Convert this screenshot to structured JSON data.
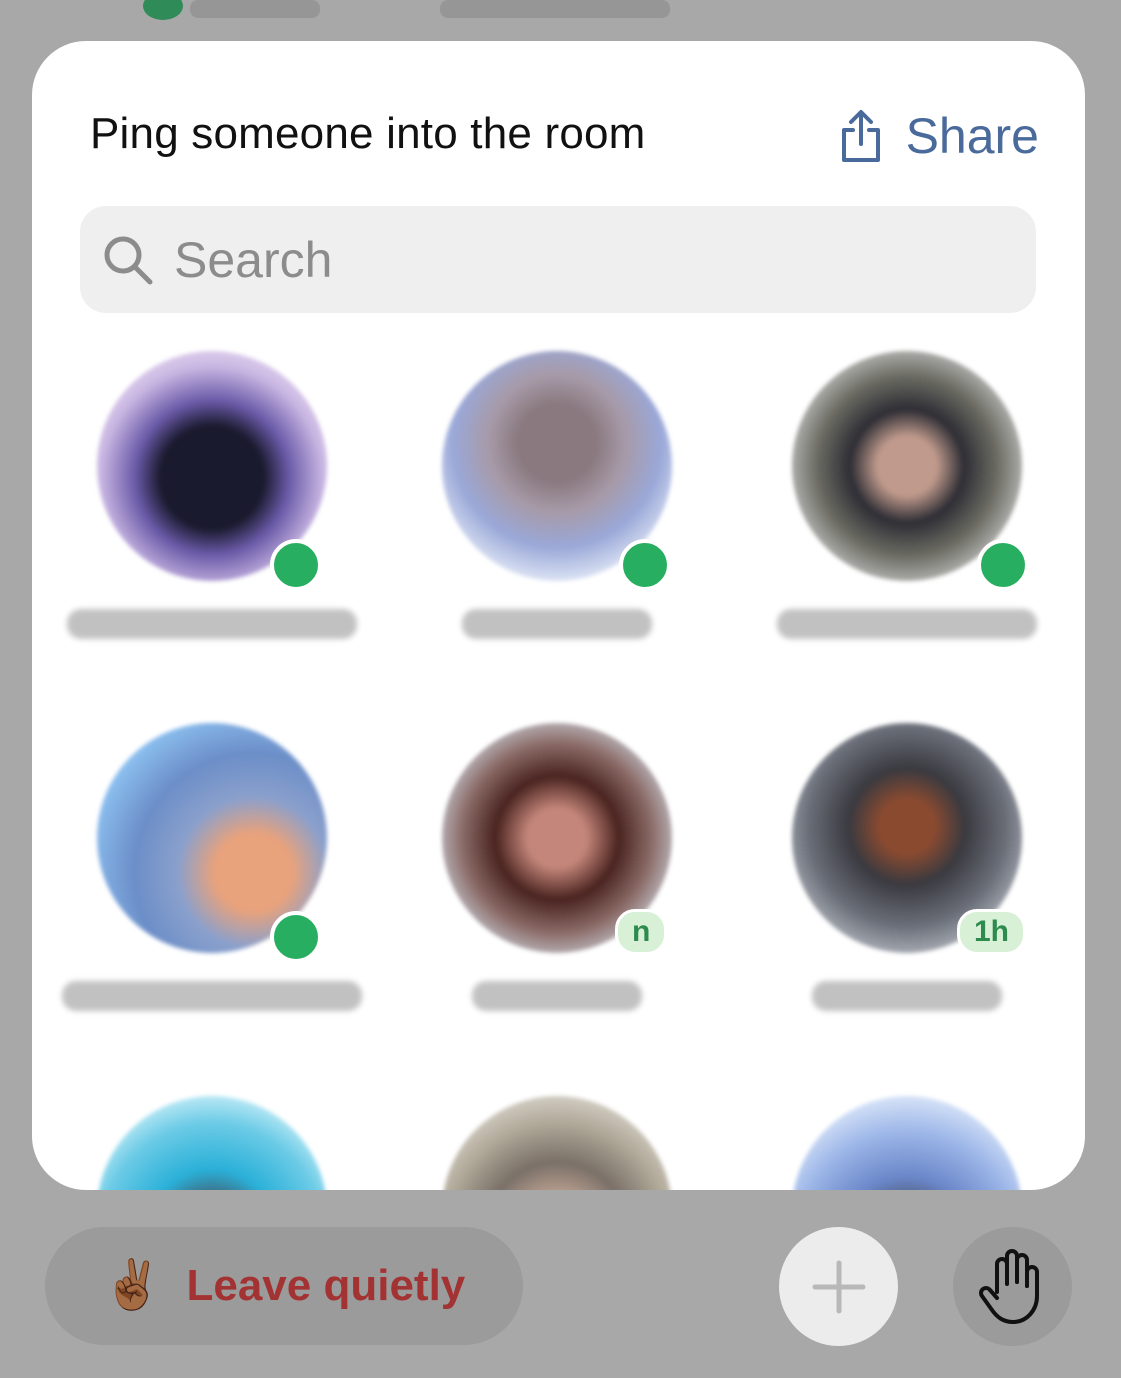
{
  "header": {
    "title": "Ping someone into the room",
    "share_label": "Share"
  },
  "search": {
    "placeholder": "Search",
    "value": ""
  },
  "people": [
    {
      "status": "online",
      "badge": ""
    },
    {
      "status": "online",
      "badge": ""
    },
    {
      "status": "online",
      "badge": ""
    },
    {
      "status": "online",
      "badge": ""
    },
    {
      "status": "recent",
      "badge": "n"
    },
    {
      "status": "recent",
      "badge": "1h"
    },
    {
      "status": "",
      "badge": ""
    },
    {
      "status": "",
      "badge": ""
    },
    {
      "status": "",
      "badge": ""
    }
  ],
  "footer": {
    "leave_emoji": "✌🏾",
    "leave_label": "Leave quietly"
  },
  "colors": {
    "accent": "#4a6a9c",
    "online": "#27ae60",
    "leave_text": "#a33333",
    "sheet": "#ffffff",
    "dim": "#a8a8a8"
  },
  "icons": {
    "share": "share-icon",
    "search": "search-icon",
    "plus": "plus-icon",
    "hand": "raise-hand-icon"
  }
}
